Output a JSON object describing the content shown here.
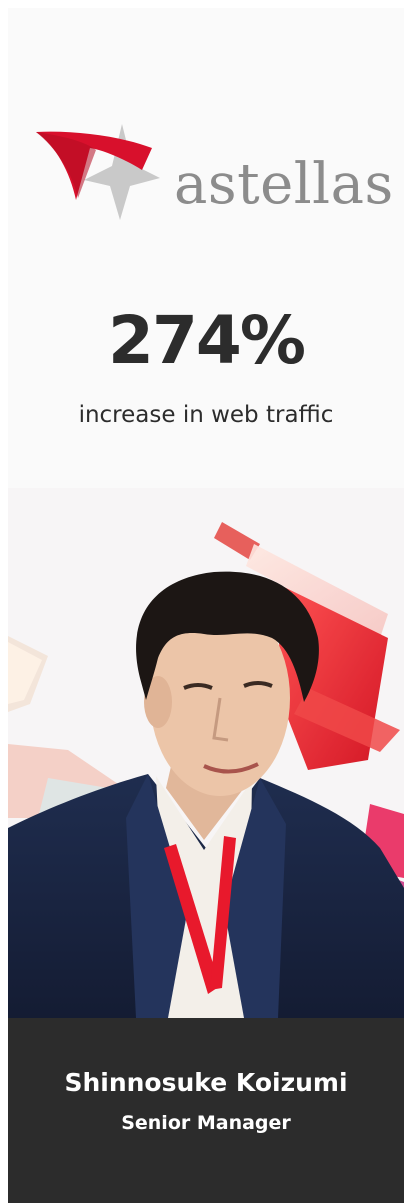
{
  "logo": {
    "wordmark": "astellas",
    "star_color": "#d8102c",
    "text_color": "#8c8c8c"
  },
  "stat": {
    "value": "274%",
    "description": "increase in web traffic"
  },
  "profile": {
    "name": "Shinnosuke Koizumi",
    "title": "Senior Manager"
  },
  "colors": {
    "caption_background": "#2c2c2c",
    "accent_red": "#e8192c"
  }
}
